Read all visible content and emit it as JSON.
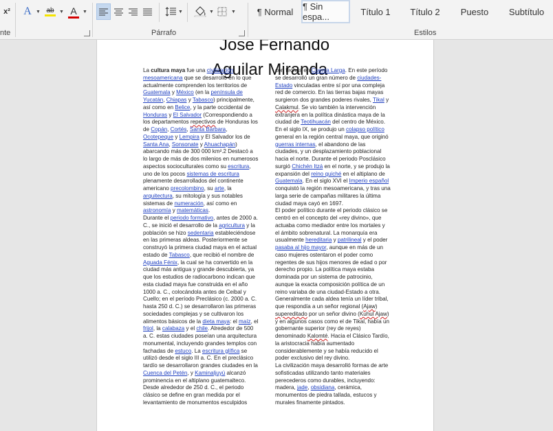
{
  "ribbon": {
    "font_tools": [
      {
        "name": "superscript-button",
        "label": "x²"
      },
      {
        "name": "text-effects-button",
        "label": "A"
      },
      {
        "name": "highlight-color-button",
        "label": "ab"
      },
      {
        "name": "font-color-button",
        "label": "A"
      }
    ],
    "font_group_label": "nte",
    "paragraph_group_label": "Párrafo",
    "styles_group_label": "Estilos",
    "highlight_color": "#f5e400",
    "font_color": "#d40000",
    "styles": [
      "¶ Normal",
      "¶ Sin espa...",
      "Título 1",
      "Título 2",
      "Puesto",
      "Subtítulo"
    ]
  },
  "document": {
    "title_line1": "Jose Fernando",
    "title_line2": "Aguilar Miranda"
  }
}
